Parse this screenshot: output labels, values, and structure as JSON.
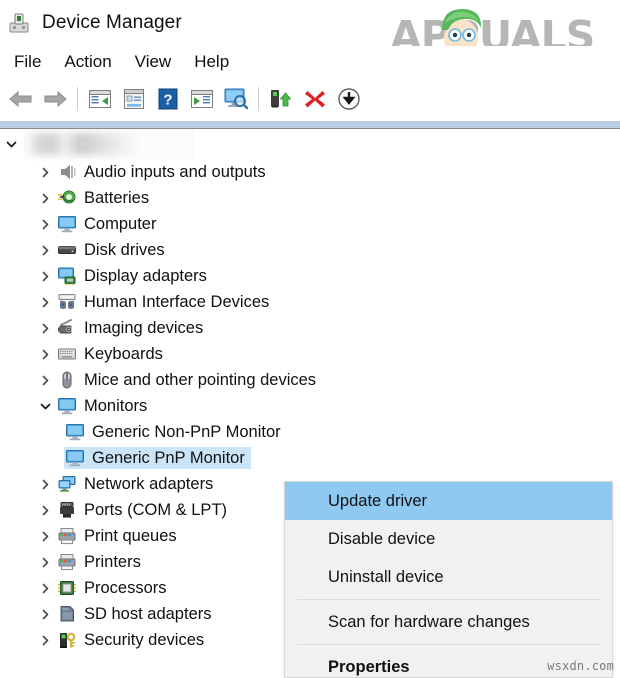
{
  "window": {
    "title": "Device Manager",
    "title_icon": "device-manager-icon"
  },
  "branding": {
    "logo_text": "APPUALS",
    "logo_color": "#b6b6b6",
    "watermark": "wsxdn.com"
  },
  "menubar": {
    "items": [
      {
        "label": "File"
      },
      {
        "label": "Action"
      },
      {
        "label": "View"
      },
      {
        "label": "Help"
      }
    ]
  },
  "toolbar": {
    "buttons": [
      {
        "name": "back-arrow-icon",
        "tip": "Back"
      },
      {
        "name": "forward-arrow-icon",
        "tip": "Forward"
      },
      {
        "name": "separator-1",
        "tip": ""
      },
      {
        "name": "show-hide-console-tree-icon",
        "tip": "Show/Hide Console Tree"
      },
      {
        "name": "properties-icon",
        "tip": "Properties"
      },
      {
        "name": "help-icon",
        "tip": "Help"
      },
      {
        "name": "action-menu-icon",
        "tip": "Action"
      },
      {
        "name": "scan-monitor-icon",
        "tip": "Scan"
      },
      {
        "name": "separator-2",
        "tip": ""
      },
      {
        "name": "update-driver-icon",
        "tip": "Update driver"
      },
      {
        "name": "uninstall-device-icon",
        "tip": "Uninstall device"
      },
      {
        "name": "disable-device-icon",
        "tip": "Disable device"
      }
    ]
  },
  "tree": {
    "root": {
      "label": "",
      "redacted": true,
      "expanded": true
    },
    "items": [
      {
        "label": "Audio inputs and outputs",
        "icon": "speaker-icon",
        "indent": 1,
        "state": "collapsed",
        "selected": false
      },
      {
        "label": "Batteries",
        "icon": "battery-icon",
        "indent": 1,
        "state": "collapsed",
        "selected": false
      },
      {
        "label": "Computer",
        "icon": "monitor-icon",
        "indent": 1,
        "state": "collapsed",
        "selected": false
      },
      {
        "label": "Disk drives",
        "icon": "disk-drive-icon",
        "indent": 1,
        "state": "collapsed",
        "selected": false
      },
      {
        "label": "Display adapters",
        "icon": "display-adapter-icon",
        "indent": 1,
        "state": "collapsed",
        "selected": false
      },
      {
        "label": "Human Interface Devices",
        "icon": "hid-icon",
        "indent": 1,
        "state": "collapsed",
        "selected": false
      },
      {
        "label": "Imaging devices",
        "icon": "camera-icon",
        "indent": 1,
        "state": "collapsed",
        "selected": false
      },
      {
        "label": "Keyboards",
        "icon": "keyboard-icon",
        "indent": 1,
        "state": "collapsed",
        "selected": false
      },
      {
        "label": "Mice and other pointing devices",
        "icon": "mouse-icon",
        "indent": 1,
        "state": "collapsed",
        "selected": false
      },
      {
        "label": "Monitors",
        "icon": "monitor-icon",
        "indent": 1,
        "state": "expanded",
        "selected": false
      },
      {
        "label": "Generic Non-PnP Monitor",
        "icon": "monitor-icon",
        "indent": 2,
        "state": "leaf",
        "selected": false
      },
      {
        "label": "Generic PnP Monitor",
        "icon": "monitor-icon",
        "indent": 2,
        "state": "leaf",
        "selected": true
      },
      {
        "label": "Network adapters",
        "icon": "network-adapter-icon",
        "indent": 1,
        "state": "collapsed",
        "selected": false
      },
      {
        "label": "Ports (COM & LPT)",
        "icon": "port-icon",
        "indent": 1,
        "state": "collapsed",
        "selected": false
      },
      {
        "label": "Print queues",
        "icon": "printer-icon",
        "indent": 1,
        "state": "collapsed",
        "selected": false
      },
      {
        "label": "Printers",
        "icon": "printer-icon",
        "indent": 1,
        "state": "collapsed",
        "selected": false
      },
      {
        "label": "Processors",
        "icon": "processor-icon",
        "indent": 1,
        "state": "collapsed",
        "selected": false
      },
      {
        "label": "SD host adapters",
        "icon": "sd-card-icon",
        "indent": 1,
        "state": "collapsed",
        "selected": false
      },
      {
        "label": "Security devices",
        "icon": "security-device-icon",
        "indent": 1,
        "state": "collapsed",
        "selected": false
      }
    ],
    "selection_color": "#cce4f7"
  },
  "context_menu": {
    "highlight_color": "#8fc9f2",
    "background_color": "#f1f1f1",
    "items": [
      {
        "label": "Update driver",
        "highlighted": true,
        "bold": false,
        "type": "item"
      },
      {
        "label": "Disable device",
        "highlighted": false,
        "bold": false,
        "type": "item"
      },
      {
        "label": "Uninstall device",
        "highlighted": false,
        "bold": false,
        "type": "item"
      },
      {
        "label": "",
        "highlighted": false,
        "bold": false,
        "type": "separator"
      },
      {
        "label": "Scan for hardware changes",
        "highlighted": false,
        "bold": false,
        "type": "item"
      },
      {
        "label": "",
        "highlighted": false,
        "bold": false,
        "type": "separator"
      },
      {
        "label": "Properties",
        "highlighted": false,
        "bold": true,
        "type": "item"
      }
    ]
  }
}
